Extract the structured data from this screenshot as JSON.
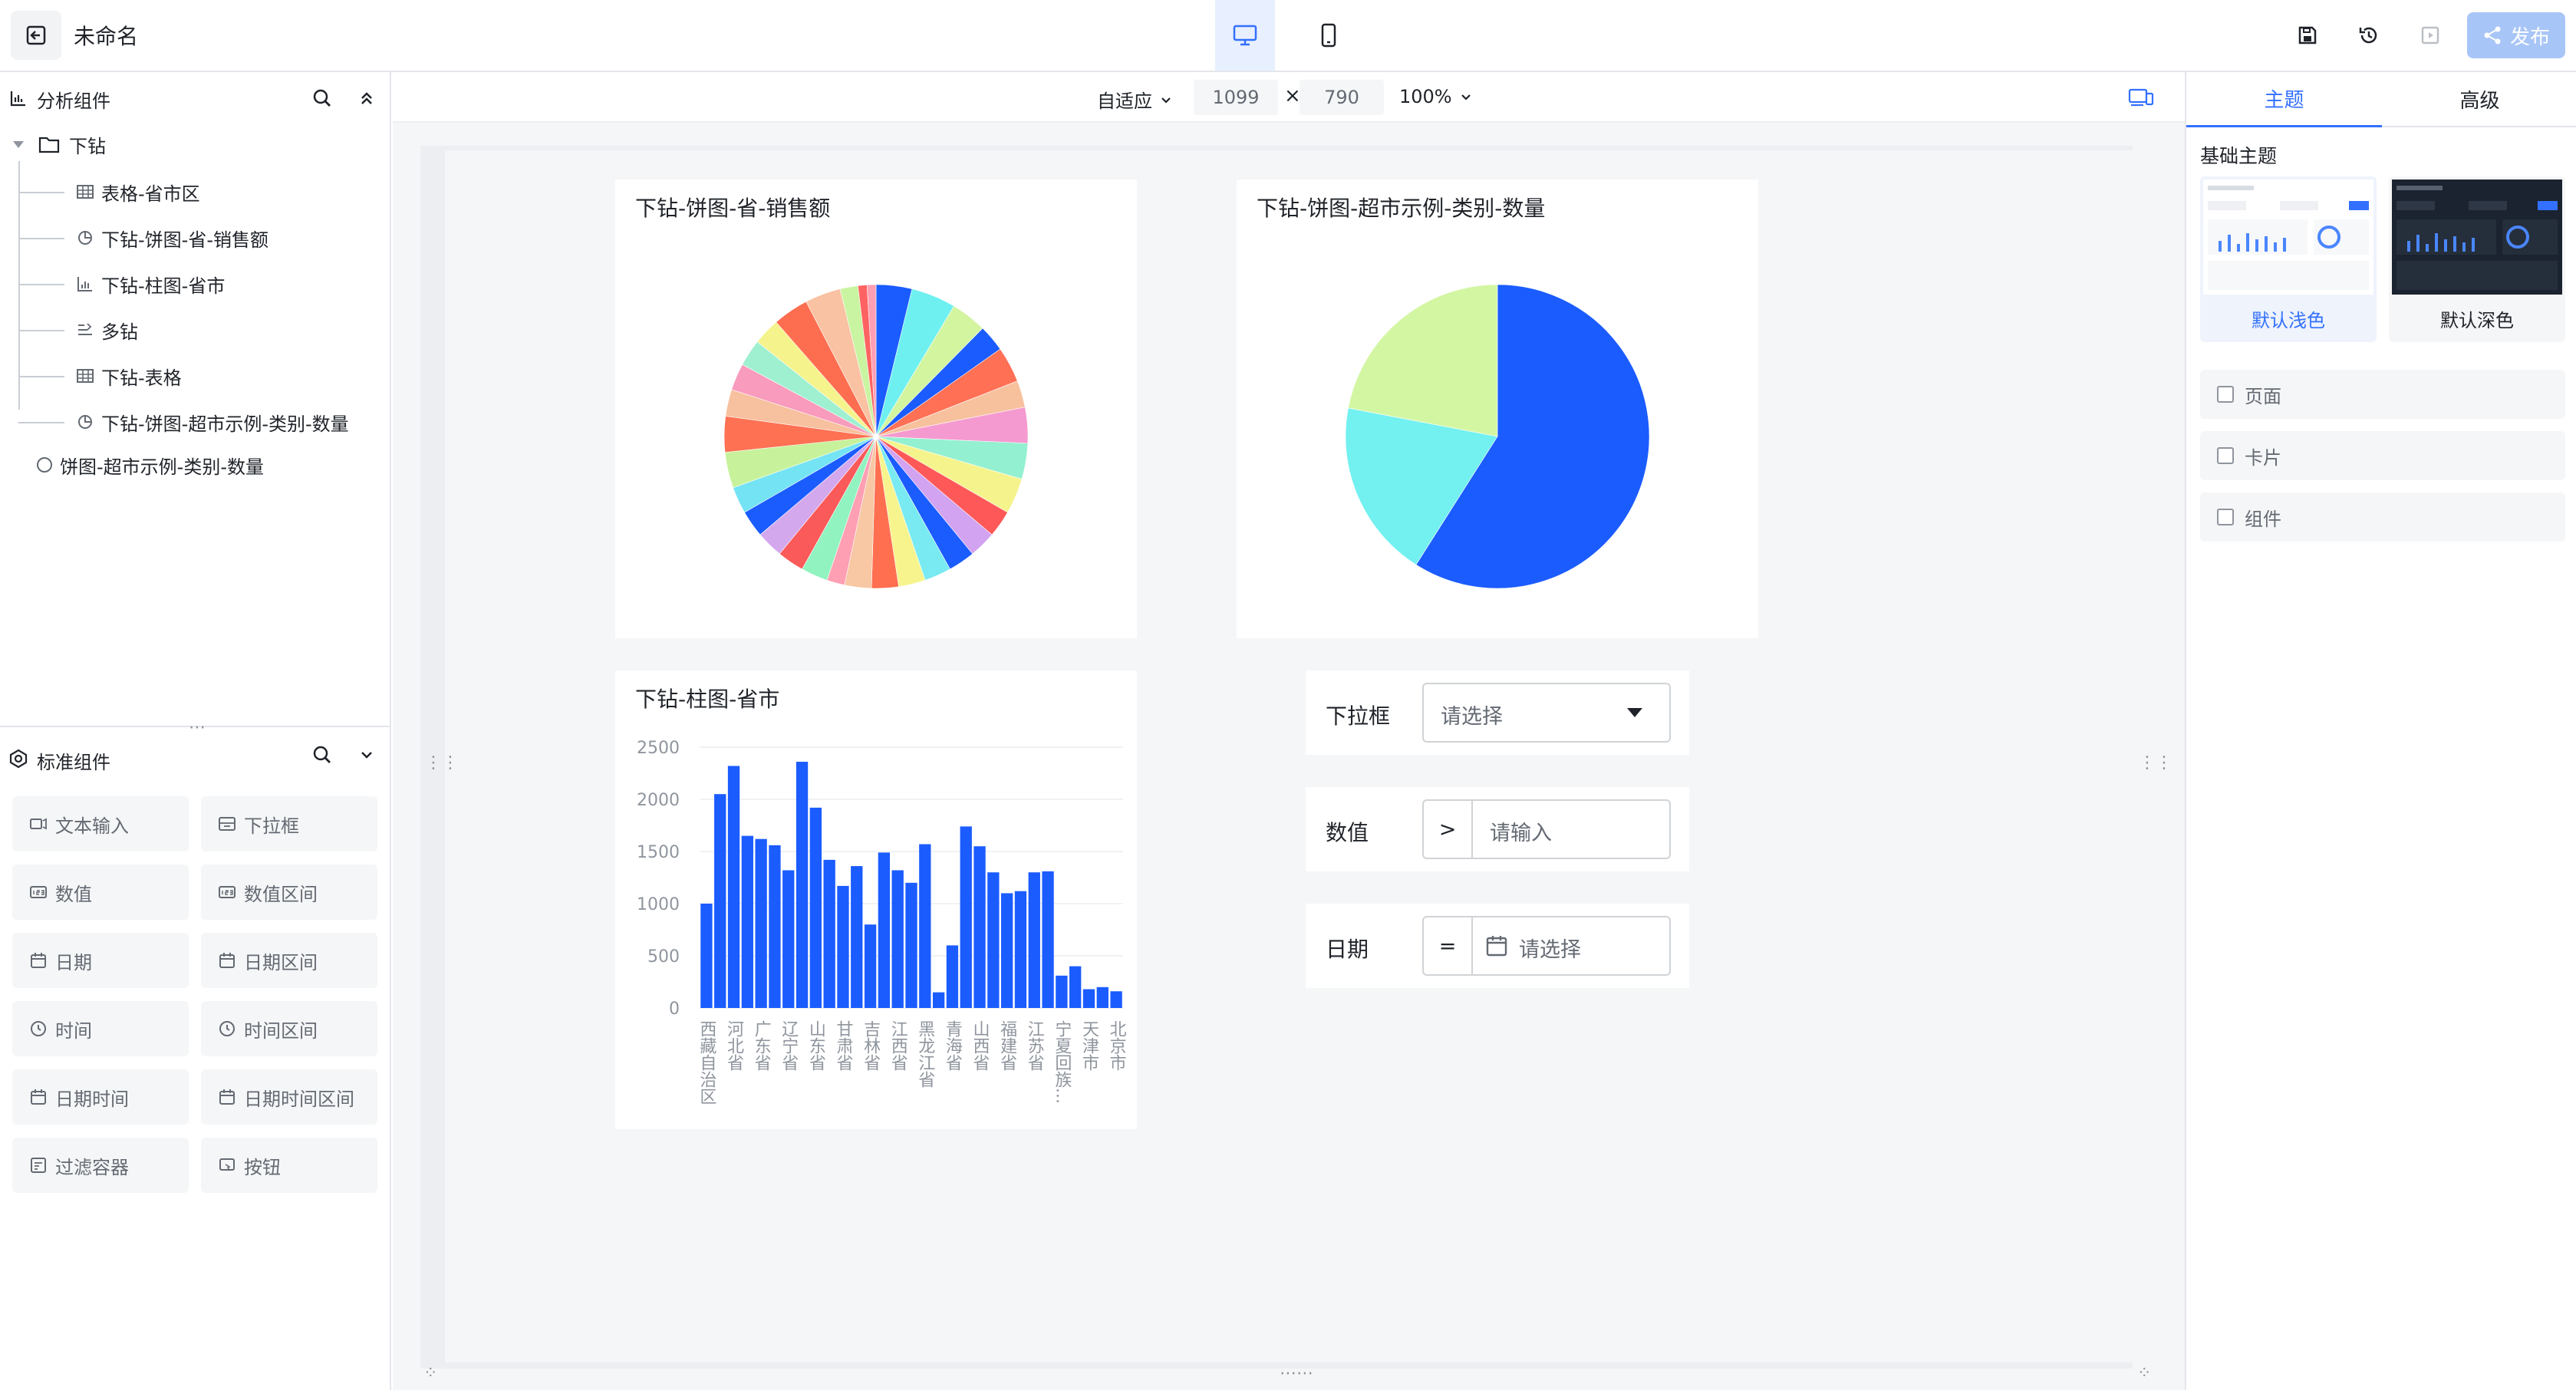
{
  "app": {
    "title": "未命名",
    "publish_label": "发布"
  },
  "left": {
    "analysis_title": "分析组件",
    "tree": {
      "folder": "下钻",
      "children": [
        {
          "label": "表格-省市区",
          "icon": "table-icon"
        },
        {
          "label": "下钻-饼图-省-销售额",
          "icon": "pie-icon"
        },
        {
          "label": "下钻-柱图-省市",
          "icon": "bar-icon"
        },
        {
          "label": "多钻",
          "icon": "multi-drill-icon"
        },
        {
          "label": "下钻-表格",
          "icon": "table-icon"
        },
        {
          "label": "下钻-饼图-超市示例-类别-数量",
          "icon": "pie-icon"
        }
      ],
      "root_item": {
        "label": "饼图-超市示例-类别-数量",
        "icon": "pie-icon"
      }
    },
    "standard_title": "标准组件",
    "widgets": [
      {
        "label": "文本输入",
        "icon": "text-input-icon"
      },
      {
        "label": "下拉框",
        "icon": "dropdown-icon"
      },
      {
        "label": "数值",
        "icon": "number-icon"
      },
      {
        "label": "数值区间",
        "icon": "number-range-icon"
      },
      {
        "label": "日期",
        "icon": "calendar-icon"
      },
      {
        "label": "日期区间",
        "icon": "calendar-icon"
      },
      {
        "label": "时间",
        "icon": "clock-icon"
      },
      {
        "label": "时间区间",
        "icon": "clock-icon"
      },
      {
        "label": "日期时间",
        "icon": "calendar-icon"
      },
      {
        "label": "日期时间区间",
        "icon": "calendar-icon"
      },
      {
        "label": "过滤容器",
        "icon": "filter-container-icon"
      },
      {
        "label": "按钮",
        "icon": "button-icon"
      }
    ]
  },
  "toolbar": {
    "fit_mode": "自适应",
    "width": "1099",
    "times": "×",
    "height": "790",
    "zoom": "100%"
  },
  "cards": {
    "pie1_title": "下钻-饼图-省-销售额",
    "pie2_title": "下钻-饼图-超市示例-类别-数量",
    "bar_title": "下钻-柱图-省市"
  },
  "filters": {
    "dropdown": {
      "label": "下拉框",
      "placeholder": "请选择"
    },
    "number": {
      "label": "数值",
      "operator": ">",
      "placeholder": "请输入"
    },
    "date": {
      "label": "日期",
      "operator": "=",
      "placeholder": "请选择"
    }
  },
  "right": {
    "tabs": [
      "主题",
      "高级"
    ],
    "base_theme_title": "基础主题",
    "themes": [
      "默认浅色",
      "默认深色"
    ],
    "checks": [
      "页面",
      "卡片",
      "组件"
    ]
  },
  "colors": {
    "accent": "#3370ff",
    "bar": "#1b5cff",
    "publish_bg": "#a8c5f7"
  },
  "chart_data": [
    {
      "type": "pie",
      "title": "下钻-饼图-省-销售额",
      "values": [
        4,
        5,
        4,
        3,
        4,
        3,
        4,
        4,
        4,
        3,
        3,
        3,
        3,
        3,
        3,
        3,
        2,
        3,
        3,
        3,
        3,
        3,
        4,
        4,
        3,
        3,
        3,
        3,
        4,
        4,
        2,
        1,
        1
      ],
      "colors": [
        "#1b5cff",
        "#6ef0f0",
        "#d3f5a0",
        "#1b5cff",
        "#ff7055",
        "#f7c19e",
        "#f59ad0",
        "#93f0d0",
        "#f5f38c",
        "#fe5859",
        "#d2a3f0",
        "#1b5cff",
        "#79eaf1",
        "#f7f48e",
        "#ff6f50",
        "#f8c7a4",
        "#ff9fb3",
        "#90f3c0",
        "#fa5a59",
        "#d4a8ed",
        "#1b5cff",
        "#74e3f3",
        "#c7f29b",
        "#fe7153",
        "#f7c09e",
        "#f89bbc",
        "#9ef0d0",
        "#f5f38c",
        "#fd6e50",
        "#f9c2a2",
        "#c9f4a1",
        "#ff6262",
        "#ff9fb3"
      ]
    },
    {
      "type": "pie",
      "title": "下钻-饼图-超市示例-类别-数量",
      "values": [
        59,
        19,
        22
      ],
      "colors": [
        "#1b5cff",
        "#73f0f0",
        "#d3f6a3"
      ]
    },
    {
      "type": "bar",
      "title": "下钻-柱图-省市",
      "ylim": [
        0,
        2500
      ],
      "yticks": [
        0,
        500,
        1000,
        1500,
        2000,
        2500
      ],
      "values": [
        1000,
        2050,
        2320,
        1650,
        1620,
        1560,
        1320,
        2360,
        1920,
        1420,
        1170,
        1360,
        800,
        1490,
        1320,
        1200,
        1570,
        150,
        600,
        1740,
        1550,
        1300,
        1100,
        1120,
        1300,
        1310,
        310,
        400,
        180,
        200,
        160
      ],
      "xlabels_shown": [
        {
          "index": 0,
          "label": "西藏自治区"
        },
        {
          "index": 2,
          "label": "河北省"
        },
        {
          "index": 4,
          "label": "广东省"
        },
        {
          "index": 6,
          "label": "辽宁省"
        },
        {
          "index": 8,
          "label": "山东省"
        },
        {
          "index": 10,
          "label": "甘肃省"
        },
        {
          "index": 12,
          "label": "吉林省"
        },
        {
          "index": 14,
          "label": "江西省"
        },
        {
          "index": 16,
          "label": "黑龙江省"
        },
        {
          "index": 18,
          "label": "青海省"
        },
        {
          "index": 20,
          "label": "山西省"
        },
        {
          "index": 22,
          "label": "福建省"
        },
        {
          "index": 24,
          "label": "江苏省"
        },
        {
          "index": 26,
          "label": "宁夏回族..."
        },
        {
          "index": 28,
          "label": "天津市"
        },
        {
          "index": 30,
          "label": "北京市"
        }
      ]
    }
  ]
}
